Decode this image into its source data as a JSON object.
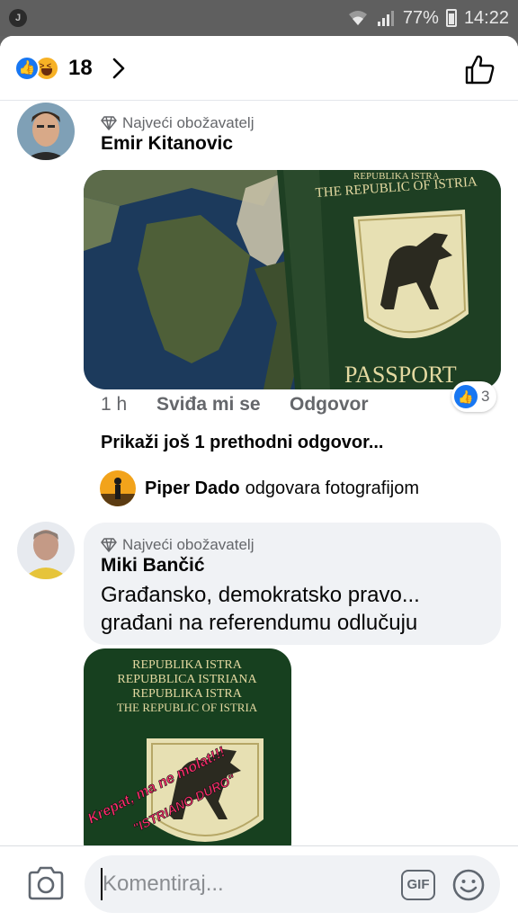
{
  "status_bar": {
    "app_badge": "J",
    "battery_percent": "77%",
    "time": "14:22"
  },
  "header": {
    "reaction_count": "18"
  },
  "comments": [
    {
      "badge": "Najveći obožavatelj",
      "author": "Emir Kitanovic",
      "photo_text": {
        "line1": "REPUBLIKA ISTRA",
        "line2": "THE REPUBLIC OF ISTRIA",
        "line3": "PASSPORT"
      },
      "time": "1 h",
      "like_label": "Sviđa mi se",
      "reply_label": "Odgovor",
      "reaction_count": "3",
      "more_replies": "Prikaži još 1 prethodni odgovor...",
      "reply_preview": {
        "name": "Piper Dado",
        "verb": "odgovara fotografijom"
      }
    },
    {
      "badge": "Najveći obožavatelj",
      "author": "Miki Bančić",
      "text_line1": "Građansko, demokratsko pravo...",
      "text_line2": "građani na referendumu odlučuju",
      "photo_text": {
        "line1": "REPUBLIKA ISTRA",
        "line2": "REPUBBLICA ISTRIANA",
        "line3": "REPUBLIKA ISTRA",
        "line4": "THE REPUBLIC OF ISTRIA",
        "overlay1": "Krepat, ma ne molat!!!",
        "overlay2": "\"ISTRIANO DURO\""
      }
    }
  ],
  "composer": {
    "placeholder": "Komentiraj...",
    "gif_label": "GIF"
  },
  "colors": {
    "accent": "#1877f2",
    "bubble": "#f0f2f5",
    "secondary_text": "#65676b"
  }
}
